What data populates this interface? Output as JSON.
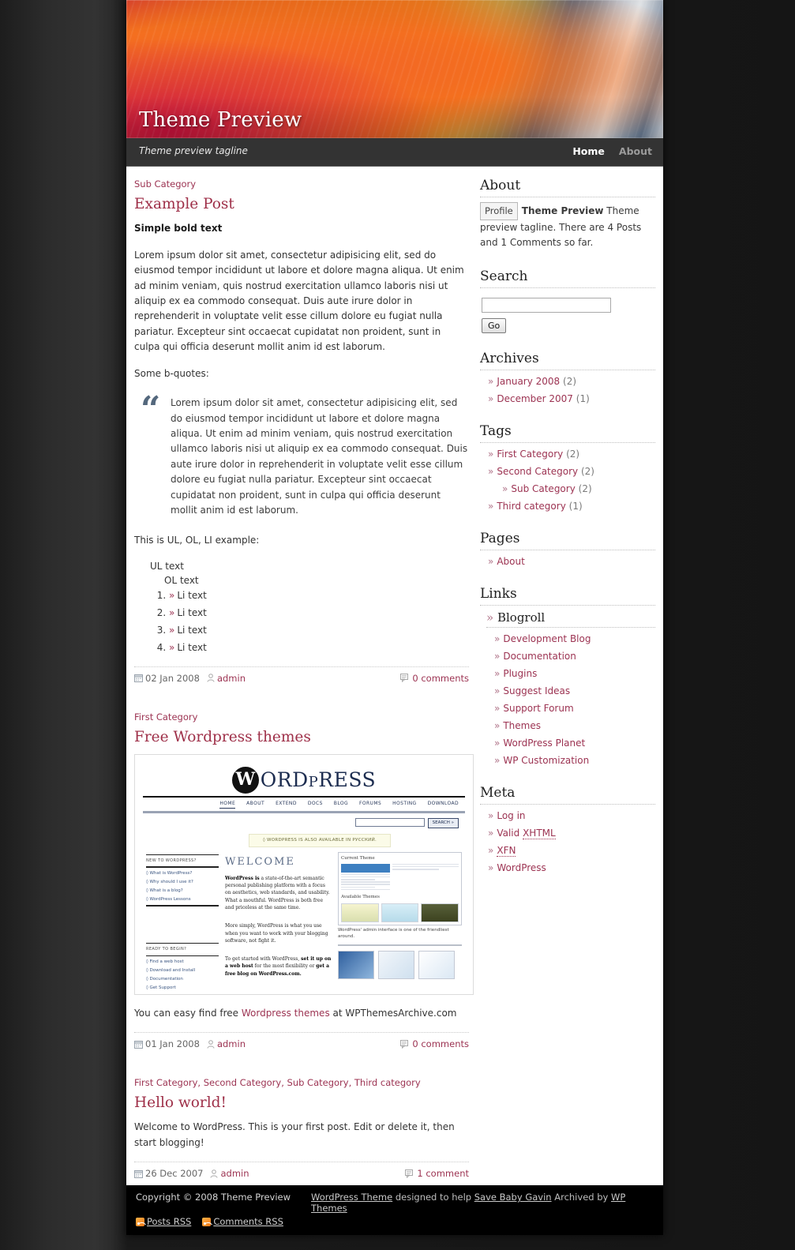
{
  "header": {
    "blog_title": "Theme Preview",
    "tagline": "Theme preview tagline",
    "nav": [
      {
        "label": "Home",
        "current": true
      },
      {
        "label": "About",
        "current": false
      }
    ]
  },
  "posts": [
    {
      "categories": "Sub Category",
      "title": "Example Post",
      "bold_intro": "Simple bold text",
      "paragraph": "Lorem ipsum dolor sit amet, consectetur adipisicing elit, sed do eiusmod tempor incididunt ut labore et dolore magna aliqua. Ut enim ad minim veniam, quis nostrud exercitation ullamco laboris nisi ut aliquip ex ea commodo consequat. Duis aute irure dolor in reprehenderit in voluptate velit esse cillum dolore eu fugiat nulla pariatur. Excepteur sint occaecat cupidatat non proident, sunt in culpa qui officia deserunt mollit anim id est laborum.",
      "quote_lead": "Some b-quotes:",
      "blockquote": "Lorem ipsum dolor sit amet, consectetur adipisicing elit, sed do eiusmod tempor incididunt ut labore et dolore magna aliqua. Ut enim ad minim veniam, quis nostrud exercitation ullamco laboris nisi ut aliquip ex ea commodo consequat. Duis aute irure dolor in reprehenderit in voluptate velit esse cillum dolore eu fugiat nulla pariatur. Excepteur sint occaecat cupidatat non proident, sunt in culpa qui officia deserunt mollit anim id est laborum.",
      "list_lead": "This is UL, OL, LI example:",
      "ul_text": "UL text",
      "ol_text": "OL text",
      "li_items": [
        "Li text",
        "Li text",
        "Li text",
        "Li text"
      ],
      "date": "02 Jan 2008",
      "author": "admin",
      "comments": "0 comments"
    },
    {
      "categories": "First Category",
      "title": "Free Wordpress themes",
      "caption_pre": "You can easy find free ",
      "caption_link": "Wordpress themes",
      "caption_post": " at WPThemesArchive.com",
      "date": "01 Jan 2008",
      "author": "admin",
      "comments": "0 comments"
    },
    {
      "categories": "First Category, Second Category, Sub Category, Third category",
      "title": "Hello world!",
      "paragraph": "Welcome to WordPress. This is your first post. Edit or delete it, then start blogging!",
      "date": "26 Dec 2007",
      "author": "admin",
      "comments": "1 comment"
    }
  ],
  "wp_screenshot": {
    "brand_word": "ORD",
    "brand_word2": "RESS",
    "brand_p": "P",
    "brand_w": "W",
    "nav": [
      "HOME",
      "ABOUT",
      "EXTEND",
      "DOCS",
      "BLOG",
      "FORUMS",
      "HOSTING",
      "DOWNLOAD"
    ],
    "search_btn": "SEARCH »",
    "notice": "◊ WORDPRESS IS ALSO AVAILABLE IN РУССКИЙ.",
    "welcome": "WELCOME",
    "left_head_1": "NEW TO WORDPRESS?",
    "left_links_1": [
      "◊ What is WordPress?",
      "◊ Why should I use it?",
      "◊ What is a blog?",
      "◊ WordPress Lessons"
    ],
    "left_head_2": "READY TO BEGIN?",
    "left_links_2": [
      "◊ Find a web host",
      "◊ Download and Install",
      "◊ Documentation",
      "◊ Get Support"
    ],
    "para1_b": "WordPress is",
    "para1": " a state-of-the-art semantic personal publishing platform with a focus on aesthetics, web standards, and usability. What a mouthful. WordPress is both free and priceless at the same time.",
    "para2": "More simply, WordPress is what you use when you want to work with your blogging software, not fight it.",
    "para3_a": "To get started with WordPress, ",
    "para3_b": "set it up on a web host",
    "para3_c": " for the most flexibility or ",
    "para3_d": "get a free blog on WordPress.com.",
    "panel_title": "Current Theme",
    "panel_sub": "Available Themes",
    "admin_caption": "WordPress' admin interface is one of the friendliest around."
  },
  "sidebar": {
    "about": {
      "title": "About",
      "profile_alt": "Profile",
      "name": "Theme Preview",
      "text": "Theme preview tagline. There are 4 Posts and 1 Comments so far."
    },
    "search": {
      "title": "Search",
      "value": "",
      "placeholder": "",
      "button": "Go"
    },
    "archives": {
      "title": "Archives",
      "items": [
        {
          "label": "January 2008",
          "count": "(2)"
        },
        {
          "label": "December 2007",
          "count": "(1)"
        }
      ]
    },
    "tags": {
      "title": "Tags",
      "items": [
        {
          "label": "First Category",
          "count": "(2)",
          "children": []
        },
        {
          "label": "Second Category",
          "count": "(2)",
          "children": [
            {
              "label": "Sub Category",
              "count": "(2)"
            }
          ]
        },
        {
          "label": "Third category",
          "count": "(1)",
          "children": []
        }
      ]
    },
    "pages": {
      "title": "Pages",
      "items": [
        {
          "label": "About"
        }
      ]
    },
    "links": {
      "title": "Links",
      "group": "Blogroll",
      "items": [
        {
          "label": "Development Blog"
        },
        {
          "label": "Documentation"
        },
        {
          "label": "Plugins"
        },
        {
          "label": "Suggest Ideas"
        },
        {
          "label": "Support Forum"
        },
        {
          "label": "Themes"
        },
        {
          "label": "WordPress Planet"
        },
        {
          "label": "WP Customization"
        }
      ]
    },
    "meta": {
      "title": "Meta",
      "items": [
        {
          "label": "Log in",
          "abbr": ""
        },
        {
          "label": "Valid ",
          "abbr": "XHTML"
        },
        {
          "label": "",
          "abbr": "XFN"
        },
        {
          "label": "WordPress",
          "abbr": ""
        }
      ]
    }
  },
  "footer": {
    "copyright": "Copyright © 2008 Theme Preview",
    "credit_a": "WordPress Theme",
    "credit_mid": " designed to help ",
    "credit_b": "Save Baby Gavin",
    "credit_mid2": " Archived by ",
    "credit_c": "WP Themes",
    "posts_rss": "Posts RSS",
    "comments_rss": "Comments RSS"
  },
  "colors": {
    "accent": "#9c3352",
    "title": "#9e2f48",
    "nav_bar": "#333333",
    "footer_bg": "#000000",
    "rss_orange": "#f07818"
  }
}
